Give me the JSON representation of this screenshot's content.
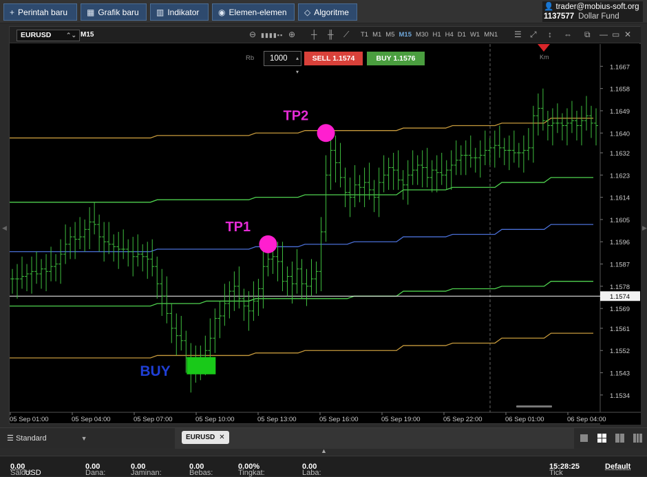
{
  "top_buttons": [
    {
      "icon": "plus-icon",
      "label": "Perintah baru"
    },
    {
      "icon": "new-chart-icon",
      "label": "Grafik baru"
    },
    {
      "icon": "indicator-icon",
      "label": "Indikator"
    },
    {
      "icon": "elements-icon",
      "label": "Elemen-elemen"
    },
    {
      "icon": "algorithm-icon",
      "label": "Algoritme"
    }
  ],
  "account": {
    "user": "trader@mobius-soft.org",
    "number": "1137577",
    "fund": "Dollar Fund"
  },
  "chart_toolbar": {
    "symbol": "EURUSD",
    "timeframe_label": "M15",
    "timeframes": [
      "T1",
      "M1",
      "M5",
      "M15",
      "M30",
      "H1",
      "H4",
      "D1",
      "W1",
      "MN1"
    ],
    "active_timeframe": "M15"
  },
  "trade_panel": {
    "rb_label": "Rb",
    "quantity": "1000",
    "sell_label": "SELL 1.1574",
    "buy_label": "BUY 1.1576"
  },
  "km_label": "Km",
  "annotations": {
    "tp2": "TP2",
    "tp1": "TP1",
    "buy": "BUY"
  },
  "colors": {
    "buy_text": "#1f3fd6",
    "tp_text": "#e62bd6",
    "tp_marker": "#ff1fcf",
    "buy_box": "#19c919",
    "candle": "#3fbf3f",
    "orange_line": "#c79a3c",
    "green_line": "#4fd24f",
    "blue_line": "#4a6fd6",
    "current_line": "#ffffff"
  },
  "chart_data": {
    "type": "line",
    "x_ticks": [
      "05 Sep 01:00",
      "05 Sep 04:00",
      "05 Sep 07:00",
      "05 Sep 10:00",
      "05 Sep 13:00",
      "05 Sep 16:00",
      "05 Sep 19:00",
      "05 Sep 22:00",
      "06 Sep 01:00",
      "06 Sep 04:00"
    ],
    "y_ticks": [
      "1.1667",
      "1.1658",
      "1.1649",
      "1.1640",
      "1.1632",
      "1.1623",
      "1.1614",
      "1.1605",
      "1.1596",
      "1.1587",
      "1.1578",
      "1.1569",
      "1.1561",
      "1.1552",
      "1.1543",
      "1.1534"
    ],
    "ylim": [
      1.1527,
      1.1676
    ],
    "current_price": "1.1574",
    "price_series": [
      1.1581,
      1.1581,
      1.1582,
      1.1583,
      1.1584,
      1.1583,
      1.1585,
      1.1584,
      1.1586,
      1.1587,
      1.1591,
      1.1595,
      1.1598,
      1.1597,
      1.1598,
      1.1601,
      1.1604,
      1.1603,
      1.1598,
      1.1596,
      1.1595,
      1.1594,
      1.1593,
      1.1593,
      1.1592,
      1.159,
      1.1591,
      1.159,
      1.1589,
      1.1586,
      1.1579,
      1.1574,
      1.1567,
      1.1561,
      1.1558,
      1.1556,
      1.1549,
      1.1543,
      1.1546,
      1.155,
      1.1552,
      1.1557,
      1.1565,
      1.1566,
      1.1571,
      1.1576,
      1.1578,
      1.1573,
      1.157,
      1.1568,
      1.1572,
      1.1577,
      1.1586,
      1.1589,
      1.159,
      1.1588,
      1.158,
      1.1582,
      1.1579,
      1.1585,
      1.1579,
      1.1578,
      1.1581,
      1.1584,
      1.16,
      1.1623,
      1.1633,
      1.1628,
      1.1622,
      1.1616,
      1.1614,
      1.1619,
      1.1618,
      1.162,
      1.1617,
      1.1614,
      1.162,
      1.1623,
      1.1626,
      1.1625,
      1.1621,
      1.1619,
      1.1623,
      1.1625,
      1.1627,
      1.1626,
      1.1622,
      1.1625,
      1.1624,
      1.1623,
      1.1625,
      1.1627,
      1.1629,
      1.1631,
      1.1631,
      1.163,
      1.163,
      1.1631,
      1.1633,
      1.1634,
      1.1635,
      1.1634,
      1.1633,
      1.1633,
      1.1632,
      1.1632,
      1.1633,
      1.1634,
      1.1647,
      1.165,
      1.1645,
      1.1643,
      1.1644,
      1.1644,
      1.1643,
      1.1644,
      1.1645,
      1.1643,
      1.1645,
      1.1647,
      1.1644,
      1.1643
    ],
    "level_lines": [
      {
        "name": "orange-upper",
        "steps": [
          1.1638,
          1.1638,
          1.1638,
          1.1639,
          1.1639,
          1.164,
          1.1641,
          1.1641,
          1.1642,
          1.1643,
          1.1644,
          1.1646
        ]
      },
      {
        "name": "green-upper",
        "steps": [
          1.1612,
          1.1612,
          1.1612,
          1.1613,
          1.1613,
          1.1614,
          1.1615,
          1.1615,
          1.1617,
          1.1618,
          1.162,
          1.1622
        ]
      },
      {
        "name": "blue-mid",
        "steps": [
          1.1592,
          1.1592,
          1.1592,
          1.1593,
          1.1593,
          1.1594,
          1.1595,
          1.1596,
          1.1598,
          1.1599,
          1.1601,
          1.1603
        ]
      },
      {
        "name": "green-lower",
        "steps": [
          1.157,
          1.157,
          1.157,
          1.1571,
          1.1572,
          1.1573,
          1.1573,
          1.1574,
          1.1576,
          1.1577,
          1.1578,
          1.158
        ]
      },
      {
        "name": "orange-lower",
        "steps": [
          1.1549,
          1.1549,
          1.1549,
          1.155,
          1.155,
          1.1551,
          1.1552,
          1.1552,
          1.1554,
          1.1555,
          1.1557,
          1.1559
        ]
      }
    ],
    "markers": [
      {
        "label": "TP2",
        "x_index": 65,
        "y": 1.164
      },
      {
        "label": "TP1",
        "x_index": 53,
        "y": 1.1595
      },
      {
        "label": "BUY",
        "x_index": 39,
        "y": 1.1546
      }
    ]
  },
  "bottom": {
    "layout_name": "Standard",
    "open_tab": "EURUSD"
  },
  "status_bar": {
    "saldo_label": "Saldo:",
    "saldo_value": "0.00",
    "saldo_currency": "USD",
    "dana_label": "Dana:",
    "dana_value": "0.00",
    "jaminan_label": "Jaminan:",
    "jaminan_value": "0.00",
    "bebas_label": "Bebas:",
    "bebas_value": "0.00",
    "tingkat_label": "Tingkat:",
    "tingkat_value": "0.00%",
    "laba_label": "Laba:",
    "laba_value": "0.00",
    "tick_label": "Tick",
    "time": "15:28:25",
    "default_label": "Default"
  }
}
